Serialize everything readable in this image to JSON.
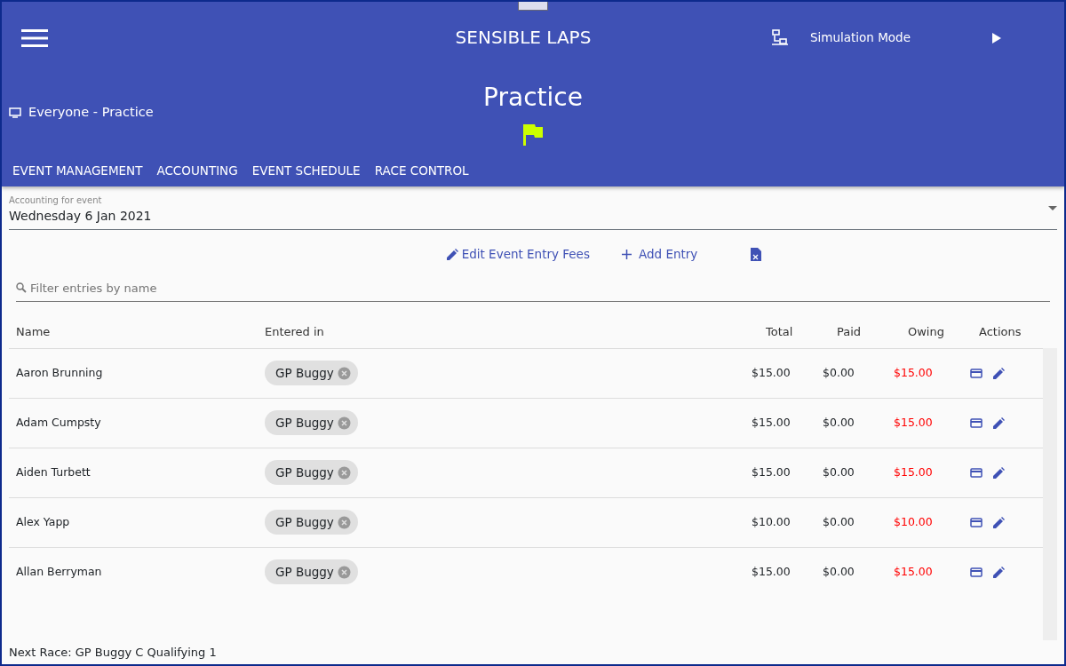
{
  "header": {
    "app_title": "SENSIBLE LAPS",
    "mode_label": "Simulation Mode",
    "display": "Everyone - Practice",
    "session_title": "Practice"
  },
  "tabs": [
    {
      "label": "EVENT MANAGEMENT"
    },
    {
      "label": "ACCOUNTING"
    },
    {
      "label": "EVENT SCHEDULE"
    },
    {
      "label": "RACE CONTROL"
    }
  ],
  "event_select": {
    "label": "Accounting for event",
    "value": "Wednesday 6 Jan 2021"
  },
  "actions": [
    {
      "kind": "edit",
      "label": "Edit Event Entry Fees"
    },
    {
      "kind": "add",
      "label": "Add Entry"
    },
    {
      "kind": "export"
    }
  ],
  "filter": {
    "placeholder": "Filter entries by name"
  },
  "table": {
    "columns": [
      "Name",
      "Entered in",
      "Total",
      "Paid",
      "Owing",
      "Actions"
    ],
    "rows": [
      {
        "name": "Aaron Brunning",
        "classes": [
          "GP Buggy"
        ],
        "total": "$15.00",
        "paid": "$0.00",
        "owing": "$15.00"
      },
      {
        "name": "Adam Cumpsty",
        "classes": [
          "GP Buggy"
        ],
        "total": "$15.00",
        "paid": "$0.00",
        "owing": "$15.00"
      },
      {
        "name": "Aiden Turbett",
        "classes": [
          "GP Buggy"
        ],
        "total": "$15.00",
        "paid": "$0.00",
        "owing": "$15.00"
      },
      {
        "name": "Alex Yapp",
        "classes": [
          "GP Buggy"
        ],
        "total": "$10.00",
        "paid": "$0.00",
        "owing": "$10.00"
      },
      {
        "name": "Allan Berryman",
        "classes": [
          "GP Buggy"
        ],
        "total": "$15.00",
        "paid": "$0.00",
        "owing": "$15.00"
      }
    ]
  },
  "status_bar": "Next Race: GP Buggy C Qualifying 1"
}
